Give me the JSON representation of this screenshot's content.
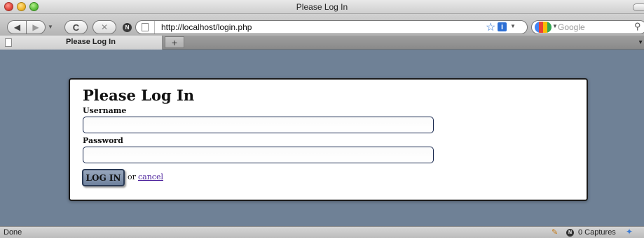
{
  "window": {
    "title": "Please Log In"
  },
  "toolbar": {
    "back_icon": "◀",
    "forward_icon": "▶",
    "reload_icon": "C",
    "stop_icon": "✕",
    "noscript_badge": "N",
    "url": "http://localhost/login.php",
    "search_placeholder": "Google"
  },
  "tabs": [
    {
      "label": "Please Log In"
    }
  ],
  "new_tab_label": "+",
  "page": {
    "title": "Please Log In",
    "username_label": "Username",
    "password_label": "Password",
    "username_value": "",
    "password_value": "",
    "login_button": "LOG IN",
    "or_text": "or",
    "cancel_link": "cancel"
  },
  "status": {
    "text": "Done",
    "captures": "0 Captures"
  },
  "colors": {
    "page_background": "#6f8196",
    "button_fill": "#7f90aa",
    "link": "#4a1f9b"
  }
}
